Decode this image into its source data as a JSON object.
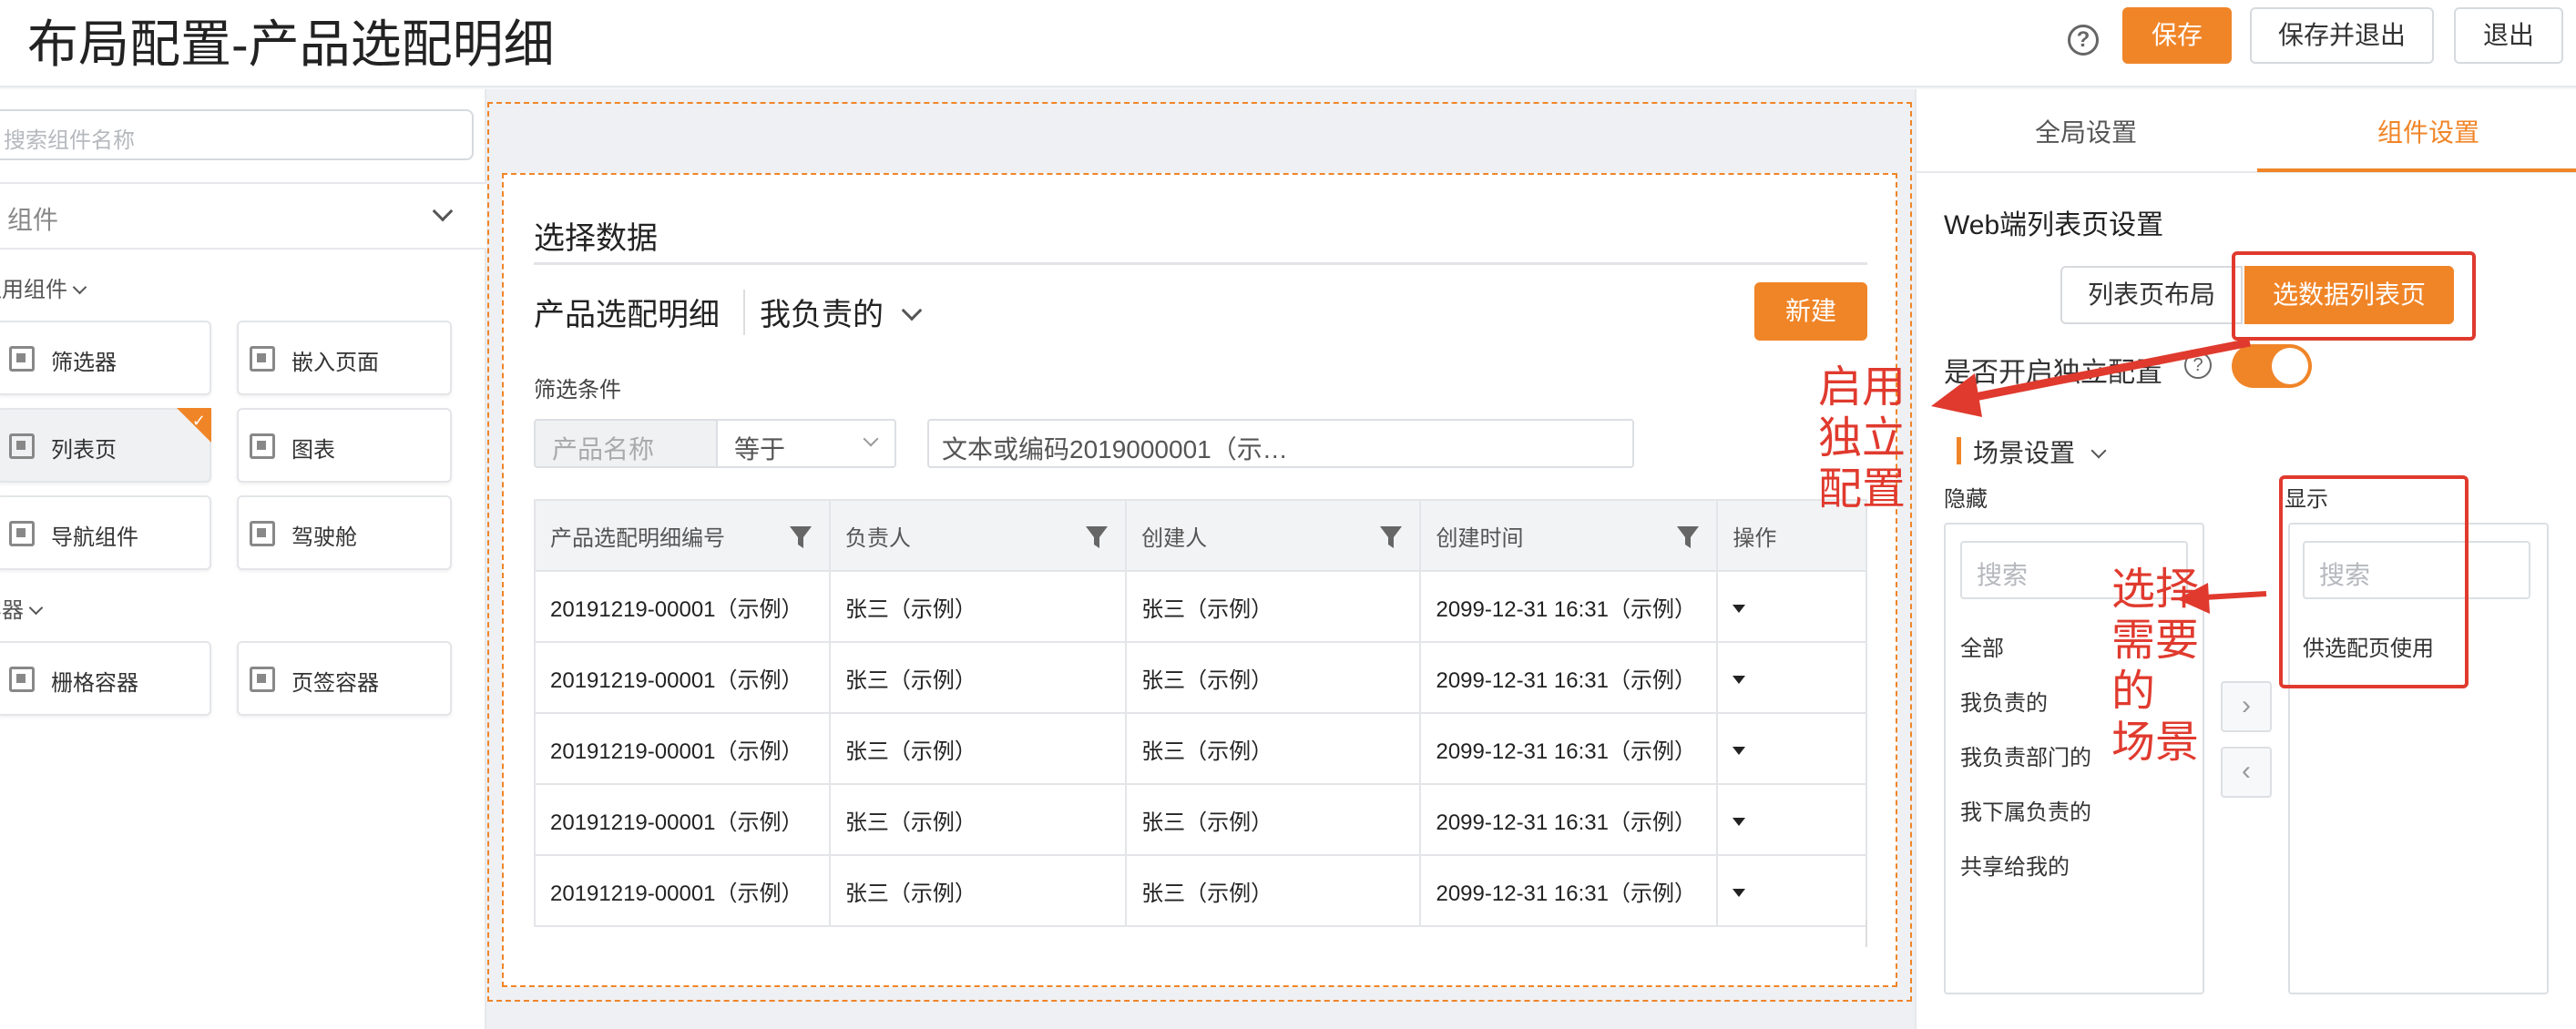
{
  "header": {
    "title": "布局配置-产品选配明细",
    "help_icon": "question-circle-icon",
    "save_label": "保存",
    "save_exit_label": "保存并退出",
    "exit_label": "退出"
  },
  "left_panel": {
    "search_placeholder": "搜索组件名称",
    "component_select": "组件",
    "groups": [
      {
        "label": "通用组件",
        "items": [
          {
            "label": "筛选器"
          },
          {
            "label": "嵌入页面"
          },
          {
            "label": "列表页",
            "selected": true
          },
          {
            "label": "图表"
          },
          {
            "label": "导航组件"
          },
          {
            "label": "驾驶舱"
          }
        ]
      },
      {
        "label": "容器",
        "items": [
          {
            "label": "栅格容器"
          },
          {
            "label": "页签容器"
          }
        ]
      }
    ]
  },
  "canvas": {
    "section_title": "选择数据",
    "list_title": "产品选配明细",
    "view_select": "我负责的",
    "new_button": "新建",
    "filter_label": "筛选条件",
    "filter_field": "产品名称",
    "filter_operator": "等于",
    "filter_value": "文本或编码2019000001（示…",
    "table": {
      "columns": [
        "产品选配明细编号",
        "负责人",
        "创建人",
        "创建时间",
        "操作"
      ],
      "rows": [
        [
          "20191219-00001（示例）",
          "张三（示例）",
          "张三（示例）",
          "2099-12-31 16:31（示例）"
        ],
        [
          "20191219-00001（示例）",
          "张三（示例）",
          "张三（示例）",
          "2099-12-31 16:31（示例）"
        ],
        [
          "20191219-00001（示例）",
          "张三（示例）",
          "张三（示例）",
          "2099-12-31 16:31（示例）"
        ],
        [
          "20191219-00001（示例）",
          "张三（示例）",
          "张三（示例）",
          "2099-12-31 16:31（示例）"
        ],
        [
          "20191219-00001（示例）",
          "张三（示例）",
          "张三（示例）",
          "2099-12-31 16:31（示例）"
        ]
      ]
    }
  },
  "right_panel": {
    "tabs": [
      "全局设置",
      "组件设置"
    ],
    "active_tab": 1,
    "title": "Web端列表页设置",
    "seg_layout": "列表页布局",
    "seg_data": "选数据列表页",
    "toggle_label": "是否开启独立配置",
    "toggle_on": true,
    "scene_label": "场景设置",
    "hidden_label": "隐藏",
    "shown_label": "显示",
    "search_placeholder": "搜索",
    "hidden_items": [
      "全部",
      "我负责的",
      "我负责部门的",
      "我下属负责的",
      "共享给我的"
    ],
    "shown_items": [
      "供选配页使用"
    ]
  },
  "annotations": {
    "enable": [
      "启用",
      "独立",
      "配置"
    ],
    "choose": [
      "选择",
      "需要",
      "的",
      "场景"
    ]
  },
  "colors": {
    "accent": "#f08528",
    "annotation_red": "#e03a2e"
  }
}
